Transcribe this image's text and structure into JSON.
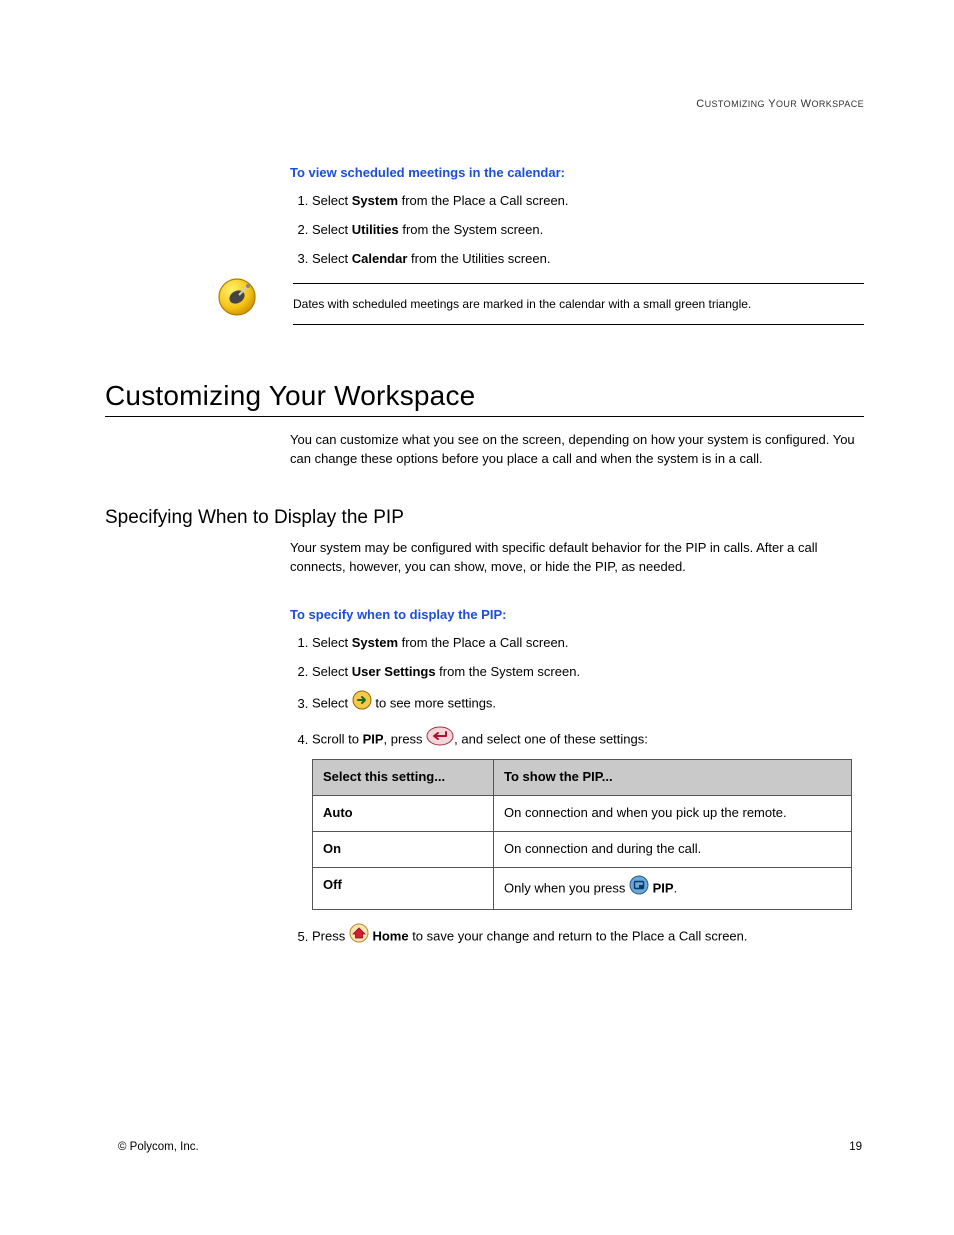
{
  "running_head": "Customizing Your Workspace",
  "sec1": {
    "proc_head": "To view scheduled meetings in the calendar:",
    "steps": [
      {
        "pre": "Select ",
        "bold": "System",
        "post": " from the Place a Call screen."
      },
      {
        "pre": "Select ",
        "bold": "Utilities",
        "post": " from the System screen."
      },
      {
        "pre": "Select ",
        "bold": "Calendar",
        "post": " from the Utilities screen."
      }
    ],
    "note": "Dates with scheduled meetings are marked in the calendar with a small green triangle."
  },
  "h1": "Customizing Your Workspace",
  "intro": "You can customize what you see on the screen, depending on how your system is configured. You can change these options before you place a call and when the system is in a call.",
  "h2": "Specifying When to Display the PIP",
  "pip_intro": "Your system may be configured with specific default behavior for the PIP in calls. After a call connects, however, you can show, move, or hide the PIP, as needed.",
  "sec2": {
    "proc_head": "To specify when to display the PIP:",
    "step1": {
      "pre": "Select ",
      "bold": "System",
      "post": " from the Place a Call screen."
    },
    "step2": {
      "pre": "Select ",
      "bold": "User Settings",
      "post": " from the System screen."
    },
    "step3": {
      "pre": "Select ",
      "post": " to see more settings."
    },
    "step4": {
      "pre": "Scroll to ",
      "bold": "PIP",
      "mid": ", press ",
      "post": ", and select one of these settings:"
    },
    "step5": {
      "pre": "Press ",
      "bold": " Home",
      "post": " to save your change and return to the Place a Call screen."
    }
  },
  "table": {
    "h1": "Select this setting...",
    "h2": "To show the PIP...",
    "rows": [
      {
        "c1": "Auto",
        "c2": "On connection and when you pick up the remote."
      },
      {
        "c1": "On",
        "c2": "On connection and during the call."
      },
      {
        "c1": "Off",
        "c2_pre": "Only when you press ",
        "c2_bold": " PIP",
        "c2_post": "."
      }
    ]
  },
  "footer": {
    "left": "© Polycom, Inc.",
    "right": "19"
  }
}
